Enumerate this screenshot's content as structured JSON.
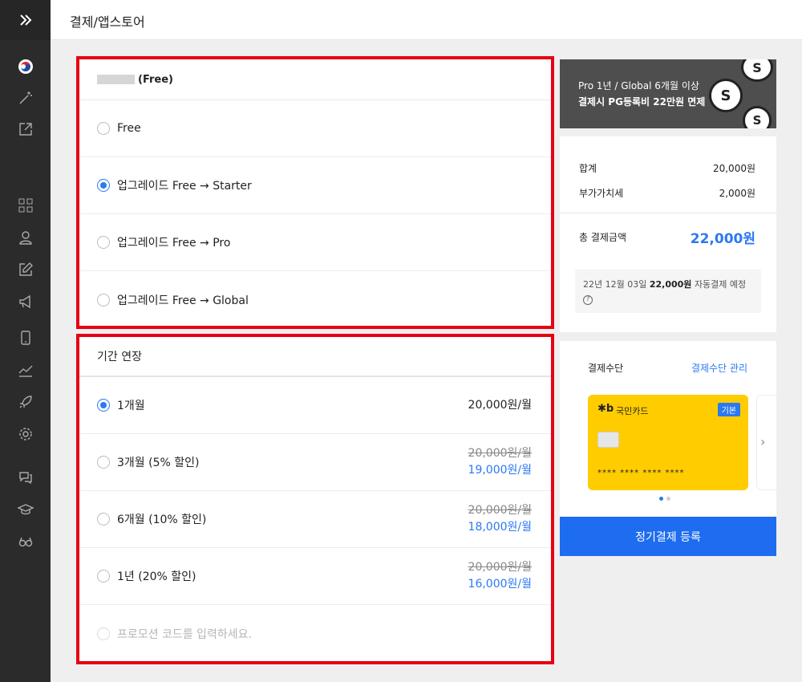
{
  "header": {
    "title": "결제/앱스토어"
  },
  "plan": {
    "heading_suffix": "(Free)",
    "options": [
      {
        "label": "Free",
        "selected": false
      },
      {
        "label": "업그레이드 Free → Starter",
        "selected": true
      },
      {
        "label": "업그레이드 Free → Pro",
        "selected": false
      },
      {
        "label": "업그레이드 Free → Global",
        "selected": false
      }
    ]
  },
  "period": {
    "heading": "기간 연장",
    "options": [
      {
        "label": "1개월",
        "selected": true,
        "price": "20,000원/월"
      },
      {
        "label": "3개월 (5% 할인)",
        "selected": false,
        "old_price": "20,000원/월",
        "new_price": "19,000원/월"
      },
      {
        "label": "6개월 (10% 할인)",
        "selected": false,
        "old_price": "20,000원/월",
        "new_price": "18,000원/월"
      },
      {
        "label": "1년 (20% 할인)",
        "selected": false,
        "old_price": "20,000원/월",
        "new_price": "16,000원/월"
      }
    ],
    "promo_placeholder": "프로모션 코드를 입력하세요."
  },
  "banner": {
    "line1": "Pro 1년 / Global 6개월 이상",
    "line2": "결제시 PG등록비 22만원 면제"
  },
  "summary": {
    "subtotal_label": "합계",
    "subtotal_value": "20,000원",
    "vat_label": "부가가치세",
    "vat_value": "2,000원",
    "total_label": "총 결제금액",
    "total_value": "22,000원",
    "notice_date": "22년 12월 03일",
    "notice_amount": "22,000원",
    "notice_text": "자동결제 예정"
  },
  "payment": {
    "title": "결제수단",
    "manage": "결제수단 관리",
    "card_name": "국민카드",
    "card_badge": "기본",
    "card_number": "**** **** **** ****",
    "register_button": "정기결제 등록"
  },
  "colors": {
    "accent": "#2b79f3",
    "highlight_border": "#e60012",
    "card": "#ffcc00",
    "sidebar": "#2b2b2b"
  }
}
